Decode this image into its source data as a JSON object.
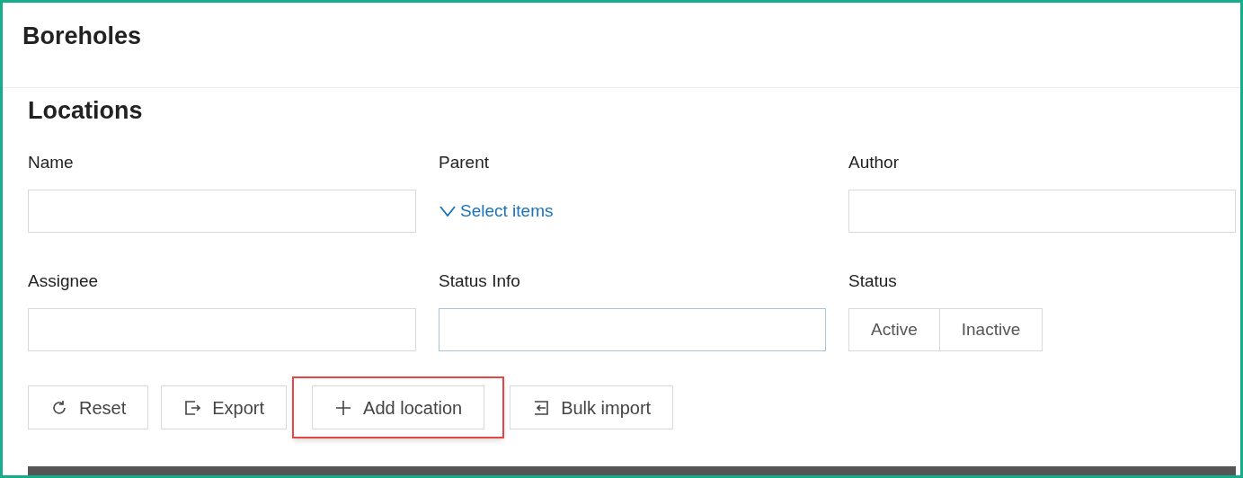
{
  "page_title": "Boreholes",
  "section_title": "Locations",
  "filters": [
    {
      "kind": "text",
      "label": "Name",
      "focused": false
    },
    {
      "kind": "select",
      "label": "Parent",
      "link": "Select items"
    },
    {
      "kind": "text",
      "label": "Author",
      "focused": false
    },
    {
      "kind": "text",
      "label": "Assignee",
      "focused": false
    },
    {
      "kind": "text",
      "label": "Status Info",
      "focused": true
    },
    {
      "kind": "segmented",
      "label": "Status",
      "options": [
        {
          "label": "Active",
          "selected": false
        },
        {
          "label": "Inactive",
          "selected": false
        }
      ]
    }
  ],
  "actions": [
    {
      "kind": "reset",
      "label": "Reset",
      "highlighted": false
    },
    {
      "kind": "export",
      "label": "Export",
      "highlighted": false
    },
    {
      "kind": "add",
      "label": "Add location",
      "highlighted": true
    },
    {
      "kind": "import",
      "label": "Bulk import",
      "highlighted": false
    }
  ]
}
